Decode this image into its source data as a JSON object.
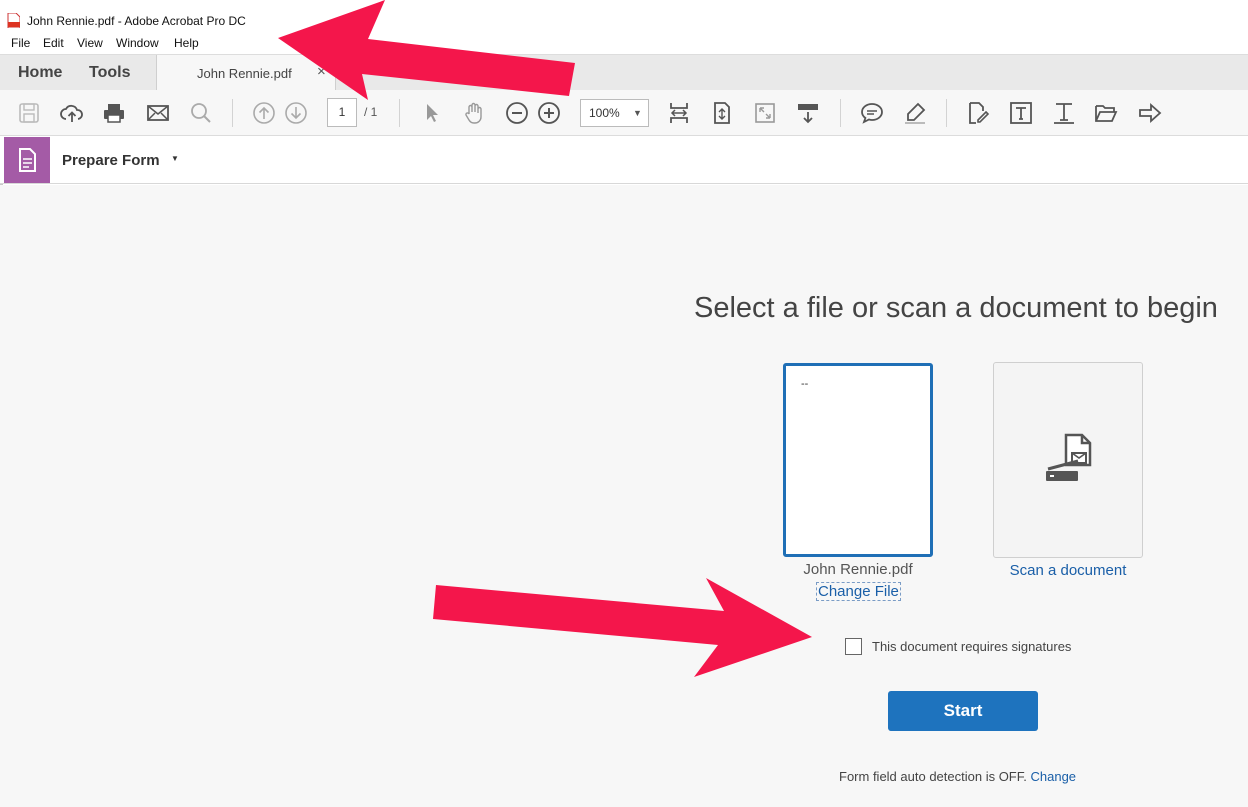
{
  "window": {
    "title": "John Rennie.pdf - Adobe Acrobat Pro DC"
  },
  "menu": {
    "file": "File",
    "edit": "Edit",
    "view": "View",
    "window": "Window",
    "help": "Help"
  },
  "tabs": {
    "home": "Home",
    "tools": "Tools",
    "document": "John Rennie.pdf",
    "close_glyph": "×"
  },
  "toolbar": {
    "page_current": "1",
    "page_total": "/ 1",
    "zoom": "100%",
    "zoom_caret": "▼",
    "icons": [
      "save-icon",
      "cloud-upload-icon",
      "print-icon",
      "email-icon",
      "search-icon",
      "page-up-icon",
      "page-down-icon",
      "select-arrow-icon",
      "hand-icon",
      "zoom-out-icon",
      "zoom-in-icon",
      "fit-page-icon",
      "scroll-mode-icon",
      "full-screen-icon",
      "read-mode-icon",
      "comment-icon",
      "highlight-icon",
      "fill-sign-icon",
      "text-box-icon",
      "add-text-icon",
      "open-folder-icon",
      "share-arrow-icon"
    ]
  },
  "tool_header": {
    "name": "Prepare Form",
    "caret": "▼"
  },
  "main": {
    "heading": "Select a file or scan a document to begin",
    "file_thumb_text": "--",
    "file_name": "John Rennie.pdf",
    "change_file": "Change File",
    "scan_link": "Scan a document",
    "signature_label": "This document requires signatures",
    "signature_checked": false,
    "start_button": "Start",
    "auto_detect_text": "Form field auto detection is OFF.",
    "auto_detect_link": "Change"
  },
  "colors": {
    "accent_blue": "#1e73be",
    "link_blue": "#1a5fa8",
    "tool_purple": "#a45ba6",
    "annotation_arrow": "#f4164b"
  }
}
